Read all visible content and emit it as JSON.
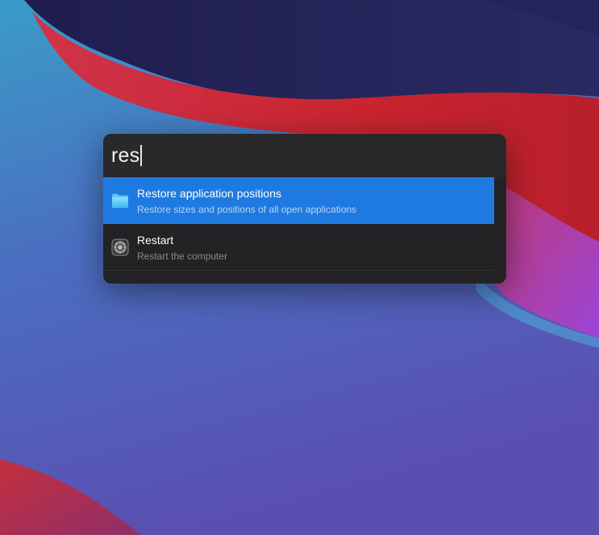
{
  "search": {
    "query": "res"
  },
  "results": [
    {
      "title": "Restore application positions",
      "subtitle": "Restore sizes and positions of all open applications",
      "icon": "folder-icon",
      "selected": true
    },
    {
      "title": "Restart",
      "subtitle": "Restart the computer",
      "icon": "system-preferences-icon",
      "selected": false
    }
  ],
  "colors": {
    "selection": "#1e7ae0",
    "panel": "#232325",
    "search_bar": "#29292b"
  }
}
